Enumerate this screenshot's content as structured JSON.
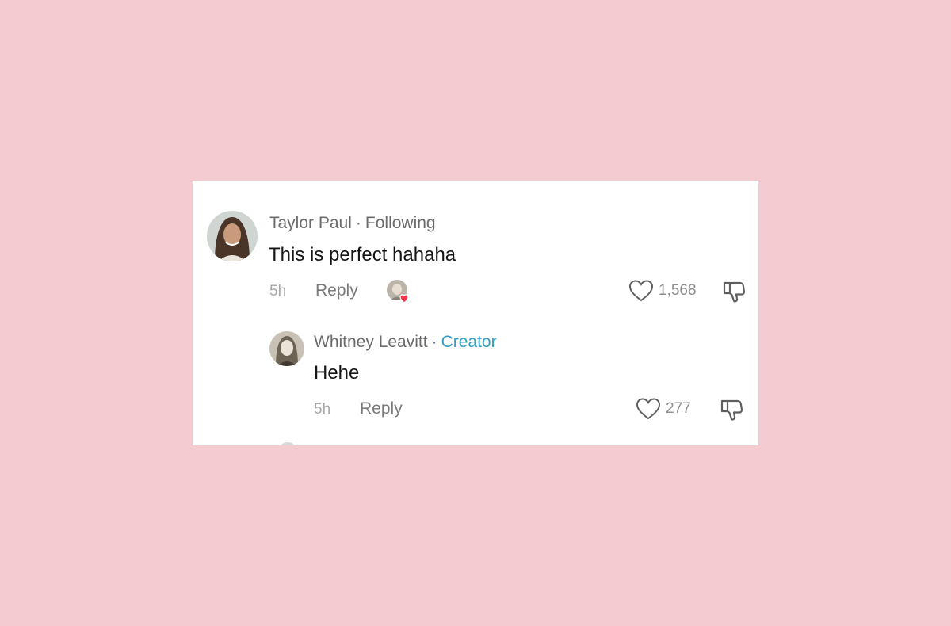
{
  "comment": {
    "author": "Taylor Paul",
    "relation": "Following",
    "separator": "·",
    "text": "This is perfect hahaha",
    "time": "5h",
    "reply_label": "Reply",
    "likes": "1,568",
    "icons": {
      "like": "heart-outline-icon",
      "dislike": "thumbs-down-icon",
      "creator_liked": "creator-liked-heart-badge"
    }
  },
  "reply": {
    "author": "Whitney Leavitt",
    "separator": "·",
    "badge": "Creator",
    "text": "Hehe",
    "time": "5h",
    "reply_label": "Reply",
    "likes": "277"
  },
  "colors": {
    "background": "#f5cbd2",
    "card": "#ffffff",
    "creator_accent": "#2f9fc6",
    "heart_badge": "#f0364f"
  }
}
